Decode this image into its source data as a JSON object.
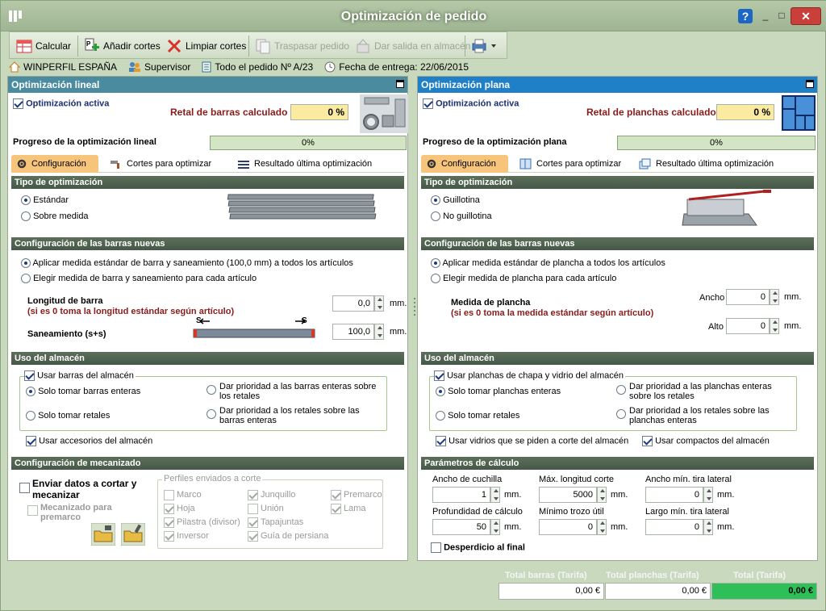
{
  "window": {
    "title": "Optimización de pedido",
    "help": "?",
    "min": "_",
    "max": "□",
    "close": "✕"
  },
  "toolbar": {
    "calcular": "Calcular",
    "anadir": "Añadir cortes",
    "limpiar": "Limpiar cortes",
    "traspasar": "Traspasar pedido",
    "dar_salida": "Dar salida en almacén"
  },
  "infobar": {
    "company": "WINPERFIL ESPAÑA",
    "user": "Supervisor",
    "order": "Todo el pedido Nº A/23",
    "delivery": "Fecha de entrega: 22/06/2015"
  },
  "linear": {
    "header": "Optimización lineal",
    "active_label": "Optimización activa",
    "retal_label": "Retal de barras calculado",
    "retal_value": "0 %",
    "progress_label": "Progreso de la optimización lineal",
    "progress_text": "0%",
    "progress_fraction": 0,
    "tabs": [
      "Configuración",
      "Cortes para optimizar",
      "Resultado última optimización"
    ],
    "tipo_header": "Tipo de optimización",
    "tipo_options": [
      "Estándar",
      "Sobre medida"
    ],
    "barras_header": "Configuración de las barras nuevas",
    "barras_options": [
      "Aplicar medida estándar de barra y saneamiento (100,0 mm) a todos los artículos",
      "Elegir medida de barra y saneamiento para cada artículo"
    ],
    "longitud_label": "Longitud de barra",
    "longitud_note": "(si es 0 toma la longitud estándar según artículo)",
    "longitud_value": "0,0",
    "saneamiento_label": "Saneamiento (s+s)",
    "saneamiento_value": "100,0",
    "s_mark": "S",
    "mm": "mm.",
    "almacen_header": "Uso del almacén",
    "usar_barras": "Usar barras del almacén",
    "solo_enteras": "Solo tomar barras enteras",
    "solo_retales": "Solo tomar retales",
    "prio_enteras": "Dar prioridad a las barras enteras sobre los retales",
    "prio_retales": "Dar prioridad a los retales sobre las barras enteras",
    "usar_accesorios": "Usar accesorios del almacén",
    "mecanizado_header": "Configuración de mecanizado",
    "enviar_datos": "Enviar datos a cortar y mecanizar",
    "mecanizado_premarco": "Mecanizado para premarco",
    "perfiles_title": "Perfiles enviados a corte",
    "perfiles": [
      {
        "label": "Marco",
        "checked": false
      },
      {
        "label": "Junquillo",
        "checked": true
      },
      {
        "label": "Premarco",
        "checked": true
      },
      {
        "label": "Hoja",
        "checked": true
      },
      {
        "label": "Unión",
        "checked": false
      },
      {
        "label": "Lama",
        "checked": true
      },
      {
        "label": "Pilastra (divisor)",
        "checked": true
      },
      {
        "label": "Tapajuntas",
        "checked": true
      },
      {
        "label": "Inversor",
        "checked": true
      },
      {
        "label": "Guía de persiana",
        "checked": true
      }
    ]
  },
  "plana": {
    "header": "Optimización plana",
    "active_label": "Optimización activa",
    "retal_label": "Retal de planchas calculado",
    "retal_value": "0 %",
    "progress_label": "Progreso de la optimización plana",
    "progress_text": "0%",
    "progress_fraction": 0,
    "tabs": [
      "Configuración",
      "Cortes para optimizar",
      "Resultado última optimización"
    ],
    "tipo_header": "Tipo de optimización",
    "tipo_options": [
      "Guillotina",
      "No guillotina"
    ],
    "barras_header": "Configuración de las barras nuevas",
    "barras_options": [
      "Aplicar medida estándar de plancha a todos los artículos",
      "Elegir medida de plancha para cada artículo"
    ],
    "medida_label": "Medida de plancha",
    "medida_note": "(si es 0 toma la medida estándar según artículo)",
    "ancho_label": "Ancho",
    "ancho_value": "0",
    "alto_label": "Alto",
    "alto_value": "0",
    "mm": "mm.",
    "almacen_header": "Uso del almacén",
    "usar_planchas": "Usar planchas de chapa y vidrio del almacén",
    "solo_enteras": "Solo tomar planchas enteras",
    "solo_retales": "Solo tomar retales",
    "prio_enteras": "Dar prioridad a las planchas enteras sobre los retales",
    "prio_retales": "Dar prioridad a los retales sobre las planchas enteras",
    "usar_vidrios": "Usar vidrios que se piden a corte del almacén",
    "usar_compactos": "Usar compactos del almacén",
    "params_header": "Parámetros de cálculo",
    "params": [
      {
        "label": "Ancho de cuchilla",
        "value": "1"
      },
      {
        "label": "Máx. longitud corte",
        "value": "5000"
      },
      {
        "label": "Ancho mín. tira lateral",
        "value": "0"
      },
      {
        "label": "Profundidad de cálculo",
        "value": "50"
      },
      {
        "label": "Mínimo trozo útil",
        "value": "0"
      },
      {
        "label": "Largo mín. tira lateral",
        "value": "0"
      }
    ],
    "desperdicio": "Desperdicio al final"
  },
  "totals": {
    "barras_label": "Total barras (Tarifa)",
    "barras_value": "0,00 €",
    "planchas_label": "Total planchas (Tarifa)",
    "planchas_value": "0,00 €",
    "total_label": "Total (Tarifa)",
    "total_value": "0,00 €"
  },
  "colors": {
    "linear_header": "#4a8ba0",
    "plana_header": "#1f7fc7",
    "total_green": "#2fbf58"
  }
}
